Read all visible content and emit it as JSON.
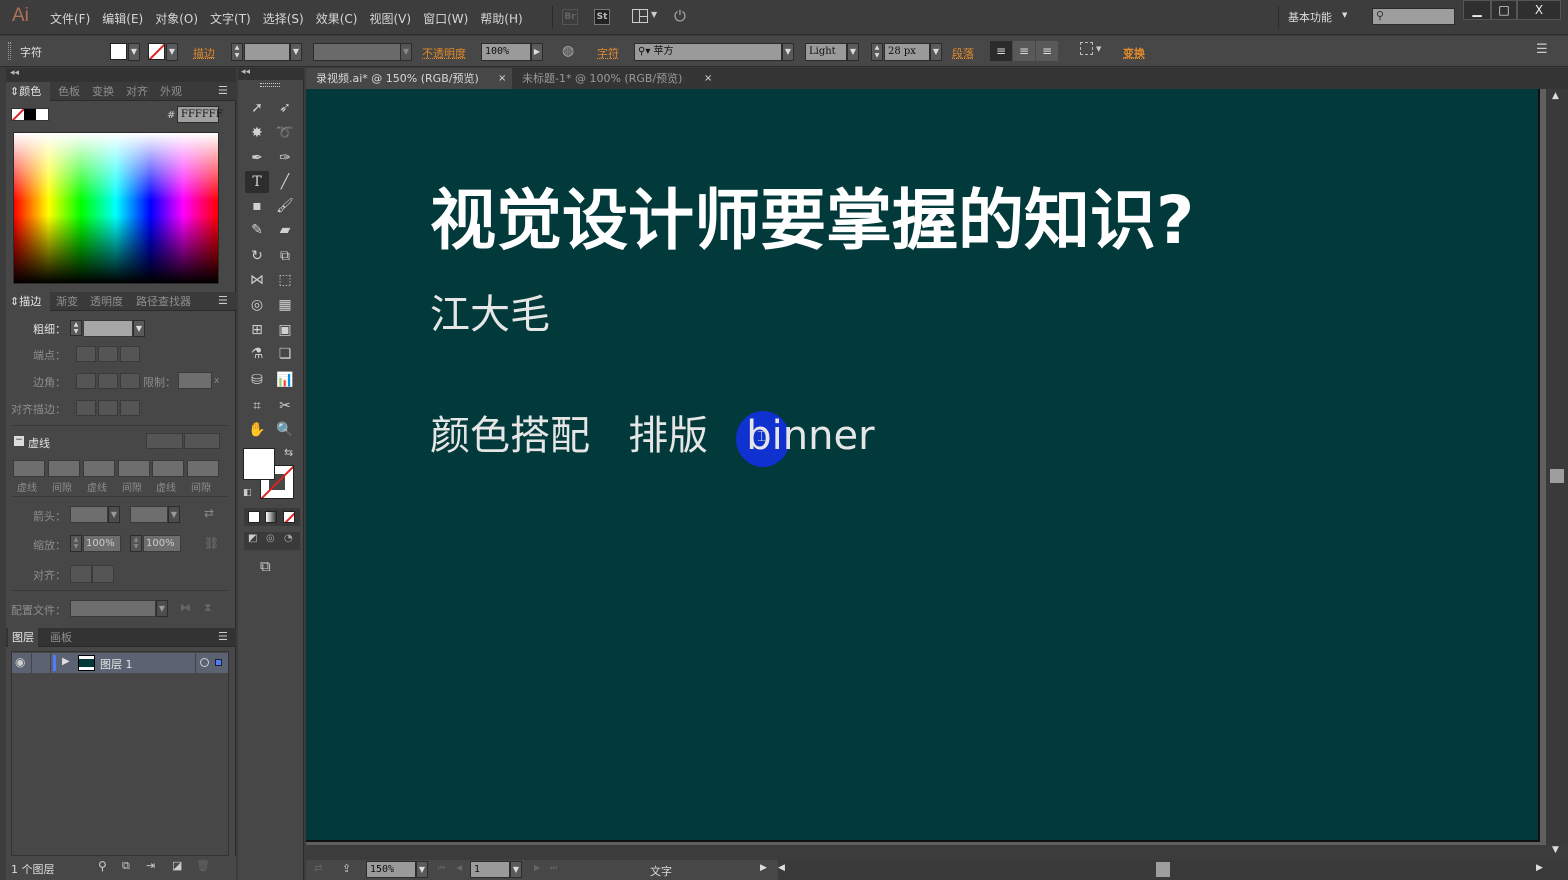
{
  "app": {
    "logo": "Ai",
    "menu": [
      "文件(F)",
      "编辑(E)",
      "对象(O)",
      "文字(T)",
      "选择(S)",
      "效果(C)",
      "视图(V)",
      "窗口(W)",
      "帮助(H)"
    ],
    "bridge_icon": "Br",
    "stock_icon": "St",
    "workspace": "基本功能",
    "search_placeholder": "",
    "window_controls": [
      "minimize",
      "maximize",
      "close"
    ]
  },
  "controlbar": {
    "panel_name": "字符",
    "stroke_label": "描边",
    "opacity_label": "不透明度",
    "opacity_value": "100%",
    "character_label": "字符",
    "font_family": "苹方",
    "font_style": "Light",
    "font_size": "28 px",
    "paragraph_label": "段落",
    "transform_label": "变换"
  },
  "color_panel": {
    "tabs": [
      "颜色",
      "色板",
      "变换",
      "对齐",
      "外观"
    ],
    "active_tab": "颜色",
    "hex_label": "#",
    "hex_value": "FFFFFF"
  },
  "stroke_panel": {
    "tabs": [
      "描边",
      "渐变",
      "透明度",
      "路径查找器"
    ],
    "active_tab": "描边",
    "weight_label": "粗细：",
    "cap_label": "端点：",
    "corner_label": "边角：",
    "limit_label": "限制：",
    "limit_suffix": "x",
    "align_label": "对齐描边：",
    "dashed_label": "虚线",
    "dash_labels": [
      "虚线",
      "间隙",
      "虚线",
      "间隙",
      "虚线",
      "间隙"
    ],
    "arrow_label": "箭头：",
    "scale_label": "缩放：",
    "scale_values": [
      "100%",
      "100%"
    ],
    "align2_label": "对齐：",
    "profile_label": "配置文件："
  },
  "layers_panel": {
    "tabs": [
      "图层",
      "画板"
    ],
    "active_tab": "图层",
    "layers": [
      {
        "name": "图层 1",
        "color": "#4f7bff"
      }
    ],
    "count_label": "1 个图层"
  },
  "document_tabs": [
    {
      "label": "录视频.ai* @ 150% (RGB/预览)",
      "active": true
    },
    {
      "label": "未标题-1* @ 100% (RGB/预览)",
      "active": false
    }
  ],
  "artboard": {
    "background": "#02393a",
    "title": "视觉设计师要掌握的知识?",
    "author": "江大毛",
    "topics": "颜色搭配   排版   binner"
  },
  "statusbar": {
    "zoom": "150%",
    "artboard_number": "1",
    "current_tool": "文字"
  }
}
